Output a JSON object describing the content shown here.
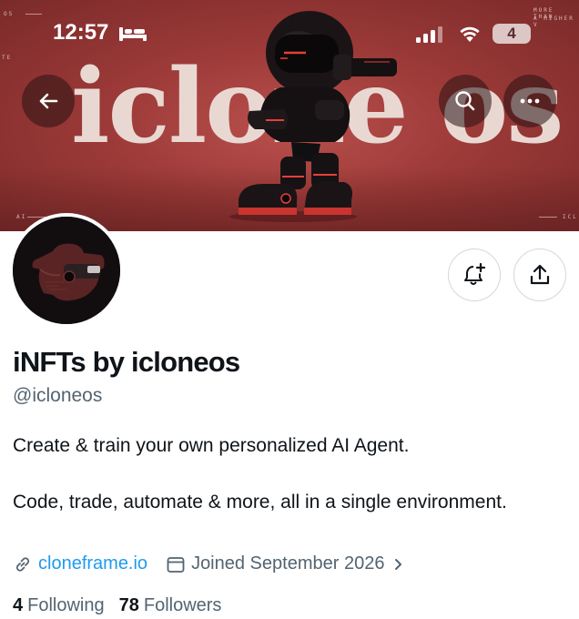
{
  "status_bar": {
    "time": "12:57",
    "battery": "4",
    "icons": [
      "bed-icon",
      "cellular-signal-icon",
      "wifi-icon"
    ]
  },
  "banner": {
    "wordmark": "iclone os",
    "corner_text_top_left": "OS",
    "corner_text_left": "TE",
    "corner_text_top_right_1": "MORE THAN",
    "corner_text_top_right_2": "A HIGHER V",
    "corner_text_bottom_left": "AI",
    "corner_text_bottom_right": "ICL",
    "background_color": "#9c3a38"
  },
  "nav": {
    "icons": [
      "back-arrow-icon",
      "search-icon",
      "more-icon"
    ]
  },
  "actions": {
    "icons": [
      "bell-plus-icon",
      "share-icon"
    ]
  },
  "profile": {
    "display_name": "iNFTs by icloneos",
    "handle": "@icloneos",
    "bio_line_1": "Create & train your own personalized AI Agent.",
    "bio_line_2": "Code, trade, automate & more, all in a single environment.",
    "website": "cloneframe.io",
    "joined": "Joined September 2026",
    "following_count": "4",
    "following_label": "Following",
    "followers_count": "78",
    "followers_label": "Followers"
  },
  "colors": {
    "link": "#1d9bf0",
    "secondary_text": "#536471",
    "primary_text": "#0f1419"
  }
}
